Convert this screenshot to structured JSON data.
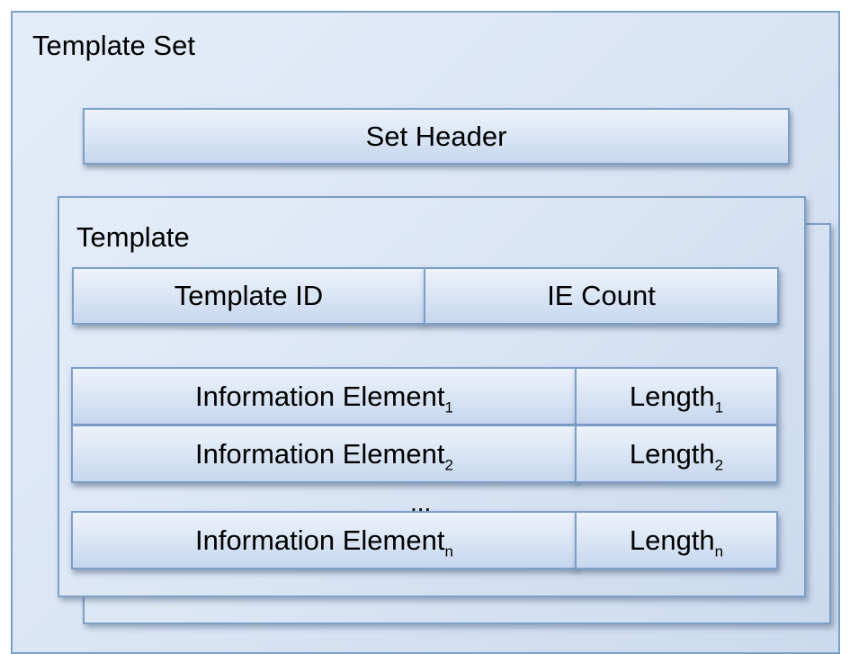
{
  "template_set": {
    "title": "Template Set",
    "set_header": "Set Header",
    "template": {
      "title": "Template",
      "header_fields": [
        "Template ID",
        "IE Count"
      ],
      "ellipsis": "...",
      "rows": [
        {
          "element": "Information Element",
          "element_sub": "1",
          "length": "Length",
          "length_sub": "1"
        },
        {
          "element": "Information Element",
          "element_sub": "2",
          "length": "Length",
          "length_sub": "2"
        },
        {
          "element": "Information Element",
          "element_sub": "n",
          "length": "Length",
          "length_sub": "n"
        }
      ]
    }
  }
}
